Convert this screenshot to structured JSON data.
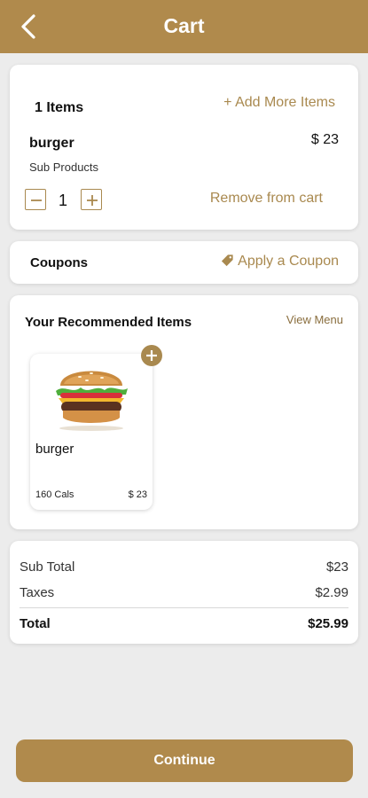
{
  "header": {
    "title": "Cart",
    "back_icon": "back-arrow-icon"
  },
  "cart": {
    "items_count": "1 Items",
    "add_more": "+ Add More Items",
    "items": [
      {
        "name": "burger",
        "price": "$ 23",
        "sub": "Sub Products",
        "quantity": "1",
        "remove": "Remove from cart"
      }
    ]
  },
  "coupons": {
    "label": "Coupons",
    "apply": "Apply a Coupon",
    "icon": "tag-icon"
  },
  "recommended": {
    "title": "Your Recommended Items",
    "view_menu": "View Menu",
    "items": [
      {
        "name": "burger",
        "cals": "160 Cals",
        "price": "$ 23",
        "image": "burger-image",
        "add_icon": "plus-icon"
      }
    ]
  },
  "summary": {
    "sub_total_label": "Sub Total",
    "sub_total": "$23",
    "taxes_label": "Taxes",
    "taxes": "$2.99",
    "total_label": "Total",
    "total": "$25.99"
  },
  "continue_label": "Continue",
  "colors": {
    "brand": "#b08a4c",
    "accent_text": "#a9894f",
    "background": "#ececec"
  }
}
